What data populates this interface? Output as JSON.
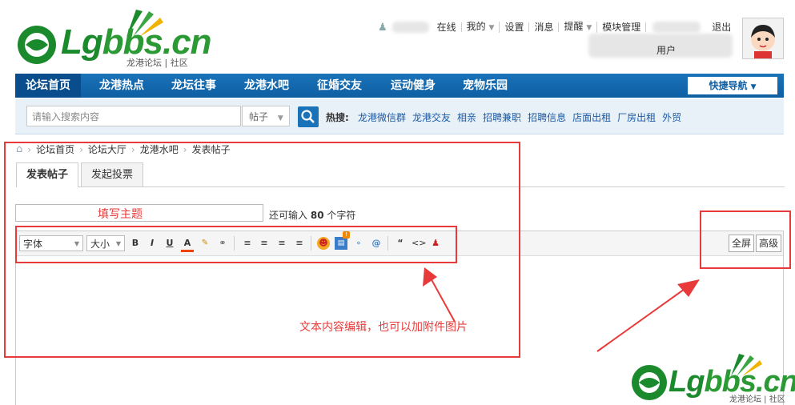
{
  "logo": {
    "text_a": "Lg",
    "text_b": "bbs.cn",
    "sub": "龙港论坛 | 社区"
  },
  "top_links": {
    "online": "在线",
    "mine": "我的",
    "settings": "设置",
    "messages": "消息",
    "remind": "提醒",
    "module": "模块管理",
    "logout": "退出",
    "user_partial": "用户"
  },
  "nav": {
    "items": [
      "论坛首页",
      "龙港热点",
      "龙坛往事",
      "龙港水吧",
      "征婚交友",
      "运动健身",
      "宠物乐园"
    ],
    "quick_nav": "快捷导航"
  },
  "search": {
    "placeholder": "请输入搜索内容",
    "type": "帖子",
    "hot_label": "热搜:",
    "hot_links": [
      "龙港微信群",
      "龙港交友",
      "相亲",
      "招聘兼职",
      "招聘信息",
      "店面出租",
      "厂房出租",
      "外贸"
    ]
  },
  "breadcrumb": [
    "论坛首页",
    "论坛大厅",
    "龙港水吧",
    "发表帖子"
  ],
  "tabs": [
    "发表帖子",
    "发起投票"
  ],
  "subject": {
    "placeholder": "填写主题",
    "remain_prefix": "还可输入",
    "remain_count": "80",
    "remain_suffix": "个字符"
  },
  "editor": {
    "font": "字体",
    "size": "大小",
    "fullscreen": "全屏",
    "advanced": "高级"
  },
  "annotation": {
    "text": "文本内容编辑，也可以加附件图片"
  },
  "watermark": {
    "text_a": "Lg",
    "text_b": "bbs.cn",
    "sub": "龙港论坛 | 社区"
  },
  "colors": {
    "nav_blue": "#1a72b8",
    "annot_red": "#e83a3a",
    "logo_green": "#1b8a2c"
  }
}
